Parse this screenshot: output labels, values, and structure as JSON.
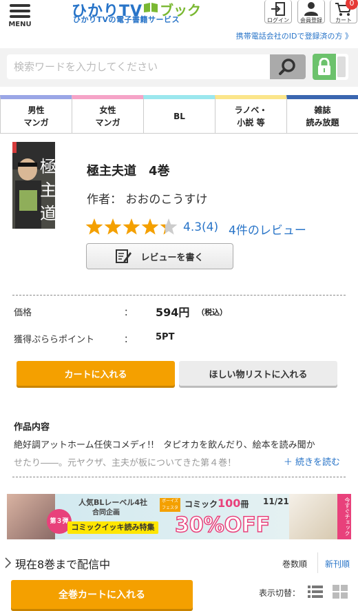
{
  "header": {
    "menu_label": "MENU",
    "logo_main": "ひかりTV",
    "logo_book": "ブック",
    "logo_sub": "ひかりTVの電子書籍サービス",
    "login_label": "ログイン",
    "member_label": "会員登録",
    "cart_label": "カート",
    "cart_count": "0",
    "carrier_link": "携帯電話会社のIDで登録済の方 》"
  },
  "search": {
    "placeholder": "検索ワードを入力してください"
  },
  "categories": [
    {
      "label": "男性\nマンガ",
      "color": "#9aa6e6"
    },
    {
      "label": "女性\nマンガ",
      "color": "#f5a3c7"
    },
    {
      "label": "BL",
      "color": "#9be7ee"
    },
    {
      "label": "ラノベ・\n小説 等",
      "color": "#fbe58a"
    },
    {
      "label": "雑誌\n読み放題",
      "color": "#3a66b0"
    }
  ],
  "product": {
    "title": "極主夫道　4巻",
    "author": "作者：  おおのこうすけ",
    "rating": "4.3(4)",
    "review_link": "4件のレビュー",
    "review_button": "レビューを書く",
    "price_label": "価格",
    "price_colon": "：",
    "price_value": "594円",
    "price_tax": "（税込）",
    "points_label": "獲得ぷららポイント",
    "points_colon": "：",
    "points_value": "5PT",
    "stars": 4.3
  },
  "actions": {
    "cart_button": "カートに入れる",
    "wishlist_button": "ほしい物リストに入れる"
  },
  "description": {
    "heading": "作品内容",
    "line1": "絶好調アットホーム任侠コメディ!!　タピオカを飲んだり、絵本を読み聞か",
    "line2": "せたり――。元ヤクザ、主夫が板についてきた第４巻！",
    "more": "＋ 続きを読む"
  },
  "banner": {
    "tag": "第３弾",
    "line1": "人気BLレーベル4社",
    "line2": "合同企画",
    "line3": "コミックイッキ読み特集",
    "feature": "ボーイズ\nフェスタ",
    "comic": "コミック",
    "comic_num": "100",
    "comic_unit": "冊",
    "date": "11/21",
    "off": "30%OFF",
    "strip": "今すぐチェック"
  },
  "volumes": {
    "status": "現在8巻まで配信中",
    "sort_volume": "巻数順",
    "sort_new": "新刊順",
    "all_cart_button": "全巻カートに入れる",
    "view_toggle_label": "表示切替："
  }
}
